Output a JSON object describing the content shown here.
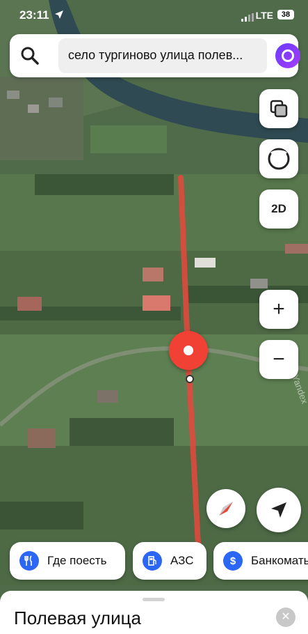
{
  "status_bar": {
    "time": "23:11",
    "network": "LTE",
    "battery": "38"
  },
  "search": {
    "query": "село тургиново улица полев..."
  },
  "map_controls": {
    "layers_icon": "layers-icon",
    "view_icon": "circle-view-icon",
    "mode_label": "2D",
    "zoom_in": "+",
    "zoom_out": "−"
  },
  "map": {
    "watermark": "Yandex",
    "route_color": "#e8473c",
    "pin_color": "#f04134"
  },
  "chips": [
    {
      "label": "Где поесть",
      "icon": "fork-knife-icon"
    },
    {
      "label": "АЗС",
      "icon": "fuel-pump-icon"
    },
    {
      "label": "Банкоматы",
      "icon": "dollar-icon"
    }
  ],
  "sheet": {
    "title": "Полевая улица",
    "close": "✕"
  }
}
